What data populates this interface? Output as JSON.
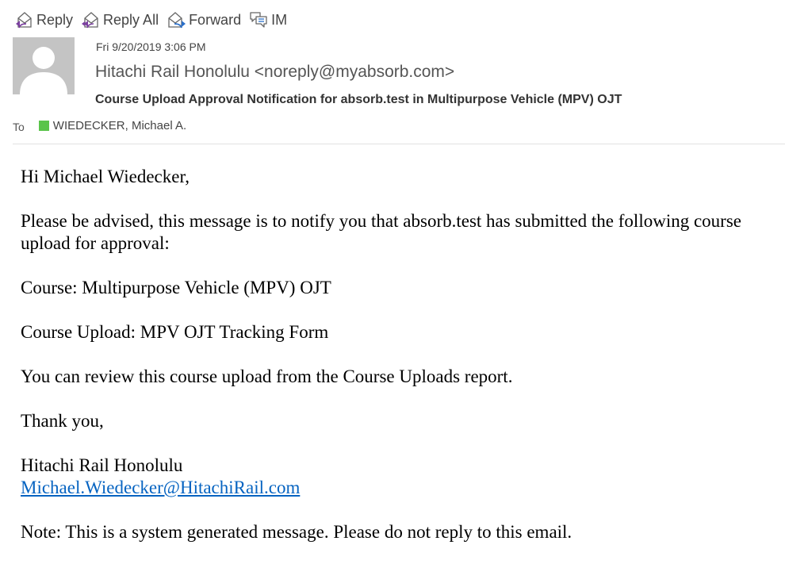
{
  "toolbar": {
    "reply_label": "Reply",
    "reply_all_label": "Reply All",
    "forward_label": "Forward",
    "im_label": "IM"
  },
  "header": {
    "date": "Fri 9/20/2019 3:06 PM",
    "sender": "Hitachi Rail Honolulu <noreply@myabsorb.com>",
    "subject": "Course Upload Approval Notification for absorb.test in Multipurpose Vehicle (MPV) OJT",
    "to_label": "To",
    "recipient": "WIEDECKER, Michael A.",
    "presence_color": "#5ac44a"
  },
  "body": {
    "greeting": "Hi Michael Wiedecker,",
    "intro": "Please be advised, this message is to notify you that absorb.test has submitted the following course upload for approval:",
    "course": "Course: Multipurpose Vehicle (MPV) OJT",
    "course_upload": "Course Upload: MPV OJT Tracking Form",
    "review": "You can review this course upload from the Course Uploads report.",
    "thanks": "Thank you,",
    "signature_name": "Hitachi Rail Honolulu",
    "signature_email": "Michael.Wiedecker@HitachiRail.com",
    "note": "Note: This is a system generated message. Please do not reply to this email."
  },
  "colors": {
    "link": "#0563c1",
    "reply_arrow": "#7b3fa0",
    "forward_arrow": "#2a6fc9",
    "avatar_bg": "#c4c4c4"
  },
  "icons": {
    "reply": "reply-icon",
    "reply_all": "reply-all-icon",
    "forward": "forward-icon",
    "im": "im-icon",
    "avatar": "avatar-silhouette"
  }
}
